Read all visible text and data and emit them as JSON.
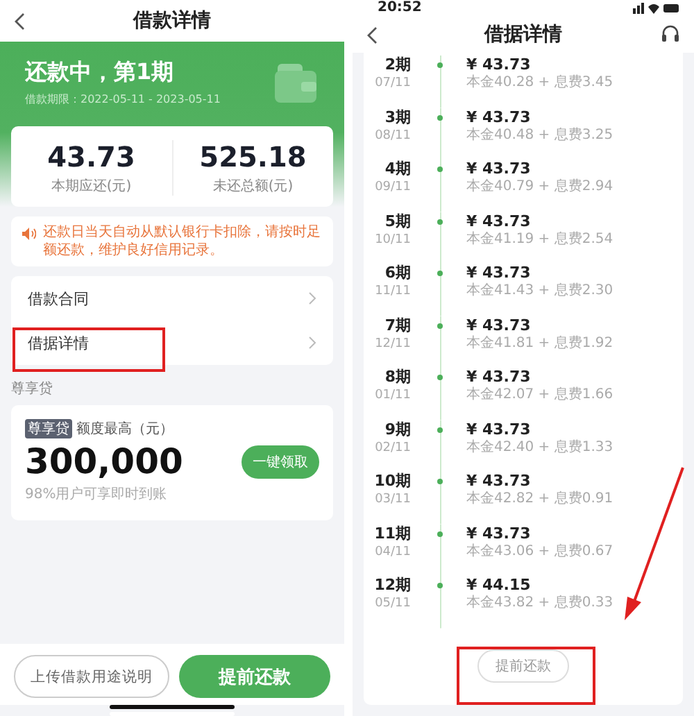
{
  "left": {
    "header": {
      "title": "借款详情"
    },
    "status": {
      "title": "还款中，第1期",
      "period": "借款期限：2022-05-11 - 2023-05-11"
    },
    "summary": [
      {
        "value": "43.73",
        "label": "本期应还(元)"
      },
      {
        "value": "525.18",
        "label": "未还总额(元)"
      }
    ],
    "notice": "还款日当天自动从默认银行卡扣除，请按时足额还款，维护良好信用记录。",
    "menu": [
      {
        "label": "借款合同"
      },
      {
        "label": "借据详情"
      }
    ],
    "section_label": "尊享贷",
    "offer": {
      "tag": "尊享贷",
      "caption": "额度最高（元）",
      "amount": "300,000",
      "note": "98%用户可享即时到账",
      "button": "一键领取"
    },
    "buttons": [
      {
        "label": "上传借款用途说明",
        "kind": "secondary"
      },
      {
        "label": "提前还款",
        "kind": "primary"
      }
    ]
  },
  "right": {
    "status_bar": {
      "time": "20:52"
    },
    "header": {
      "title": "借据详情"
    },
    "installments": [
      {
        "period": "2期",
        "date": "07/11",
        "amount": "¥ 43.73",
        "breakdown": "本金40.28 + 息费3.45"
      },
      {
        "period": "3期",
        "date": "08/11",
        "amount": "¥ 43.73",
        "breakdown": "本金40.48 + 息费3.25"
      },
      {
        "period": "4期",
        "date": "09/11",
        "amount": "¥ 43.73",
        "breakdown": "本金40.79 + 息费2.94"
      },
      {
        "period": "5期",
        "date": "10/11",
        "amount": "¥ 43.73",
        "breakdown": "本金41.19 + 息费2.54"
      },
      {
        "period": "6期",
        "date": "11/11",
        "amount": "¥ 43.73",
        "breakdown": "本金41.43 + 息费2.30"
      },
      {
        "period": "7期",
        "date": "12/11",
        "amount": "¥ 43.73",
        "breakdown": "本金41.81 + 息费1.92"
      },
      {
        "period": "8期",
        "date": "01/11",
        "amount": "¥ 43.73",
        "breakdown": "本金42.07 + 息费1.66"
      },
      {
        "period": "9期",
        "date": "02/11",
        "amount": "¥ 43.73",
        "breakdown": "本金42.40 + 息费1.33"
      },
      {
        "period": "10期",
        "date": "03/11",
        "amount": "¥ 43.73",
        "breakdown": "本金42.82 + 息费0.91"
      },
      {
        "period": "11期",
        "date": "04/11",
        "amount": "¥ 43.73",
        "breakdown": "本金43.06 + 息费0.67"
      },
      {
        "period": "12期",
        "date": "05/11",
        "amount": "¥ 44.15",
        "breakdown": "本金43.82 + 息费0.33"
      }
    ],
    "button": "提前还款"
  }
}
